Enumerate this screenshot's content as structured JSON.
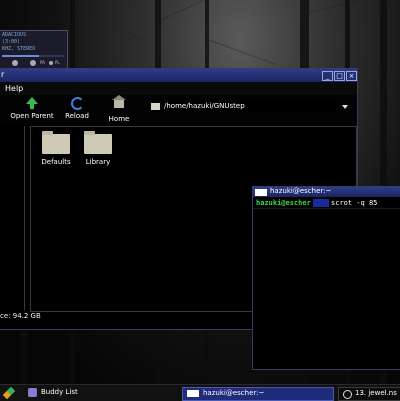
{
  "player": {
    "line1": "ADACIOUS",
    "line2": "(3:00)",
    "line3": "KHZ, STEREO",
    "toggle_a": "PA",
    "toggle_b": "PL",
    "progress": 0.6
  },
  "file_manager": {
    "title": "r",
    "menu": {
      "help": "Help"
    },
    "toolbar": {
      "open_parent": "Open Parent",
      "reload": "Reload",
      "home": "Home"
    },
    "path": "/home/hazuki/GNUstep",
    "items": [
      {
        "label": "Defaults"
      },
      {
        "label": "Library"
      }
    ],
    "status": "ce: 94.2 GB",
    "window_buttons": {
      "minimize": "_",
      "maximize": "□",
      "close": "×"
    }
  },
  "terminal": {
    "title": "hazuki@escher:~",
    "prompt_host": "hazuki@escher",
    "prompt_cwd": "~",
    "command": "scrot -q 85"
  },
  "taskbar": {
    "buddy_list": "Buddy List",
    "terminal_task": "hazuki@escher:~",
    "media_task": "13. jewel.ns"
  },
  "colors": {
    "titlebar": "#2d3d8a",
    "prompt_green": "#3fd84a",
    "accent_blue": "#1f2c7c"
  }
}
